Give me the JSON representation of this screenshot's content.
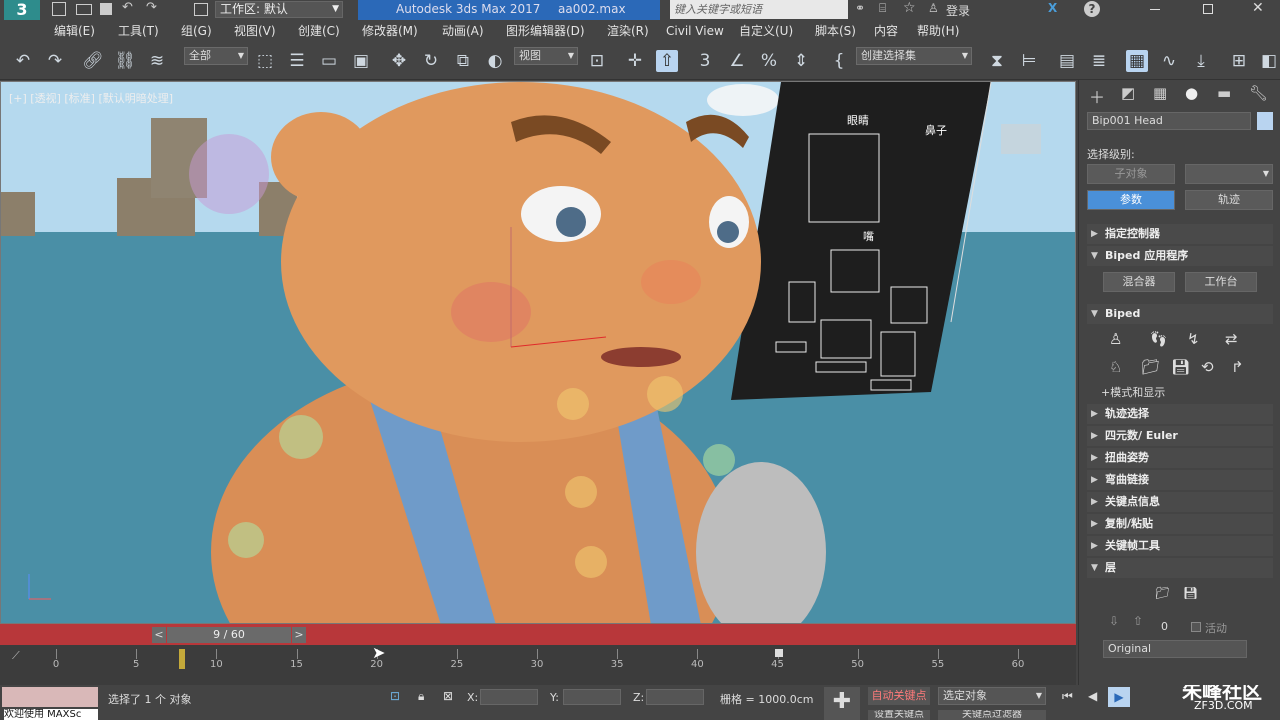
{
  "titlebar": {
    "workspace": "工作区: 默认",
    "app_title": "Autodesk 3ds Max 2017",
    "file_name": "aa002.max",
    "search_placeholder": "键入关键字或短语",
    "login": "登录"
  },
  "menu": [
    "编辑(E)",
    "工具(T)",
    "组(G)",
    "视图(V)",
    "创建(C)",
    "修改器(M)",
    "动画(A)",
    "图形编辑器(D)",
    "渲染(R)",
    "Civil View",
    "自定义(U)",
    "脚本(S)",
    "内容",
    "帮助(H)"
  ],
  "toolbar": {
    "filter_dropdown": "全部",
    "coord_dropdown": "视图",
    "selection_set": "创建选择集"
  },
  "viewport": {
    "label": "[+] [透视] [标准] [默认明暗处理]",
    "card_labels": [
      "眼睛",
      "鼻子",
      "嘴"
    ]
  },
  "timeline": {
    "frame_display": "9 / 60",
    "ticks": [
      "0",
      "5",
      "10",
      "15",
      "20",
      "25",
      "30",
      "35",
      "40",
      "45",
      "50",
      "55",
      "60"
    ]
  },
  "status": {
    "maxscript": "欢迎使用 MAXSc",
    "selection_msg": "选择了 1 个 对象",
    "x_label": "X:",
    "y_label": "Y:",
    "z_label": "Z:",
    "grid": "栅格 = 1000.0cm",
    "auto_key": "自动关键点",
    "set_key": "设置关键点",
    "selected_object": "选定对象",
    "key_filter": "关键点过滤器",
    "watermark": "朱峰社区",
    "watermark_url": "ZF3D.COM"
  },
  "command_panel": {
    "object_name": "Bip001 Head",
    "select_level": "选择级别:",
    "subobject": "子对象",
    "param_btn": "参数",
    "track_btn": "轨迹",
    "rollouts": [
      {
        "label": "指定控制器",
        "expanded": false
      },
      {
        "label": "Biped 应用程序",
        "expanded": true
      }
    ],
    "mixer": "混合器",
    "workbench": "工作台",
    "biped_rollout": "Biped",
    "mode_display": "+模式和显示",
    "rollouts2": [
      "轨迹选择",
      "四元数/ Euler",
      "扭曲姿势",
      "弯曲链接",
      "关键点信息",
      "复制/粘贴",
      "关键帧工具"
    ],
    "layer": "层",
    "layer_num": "0",
    "active": "活动",
    "original": "Original"
  },
  "colors": {
    "accent": "#2b69b8",
    "timebar": "#b8373a",
    "viewport_sky": "#b5d9ee",
    "viewport_sea": "#4a8fa6"
  }
}
